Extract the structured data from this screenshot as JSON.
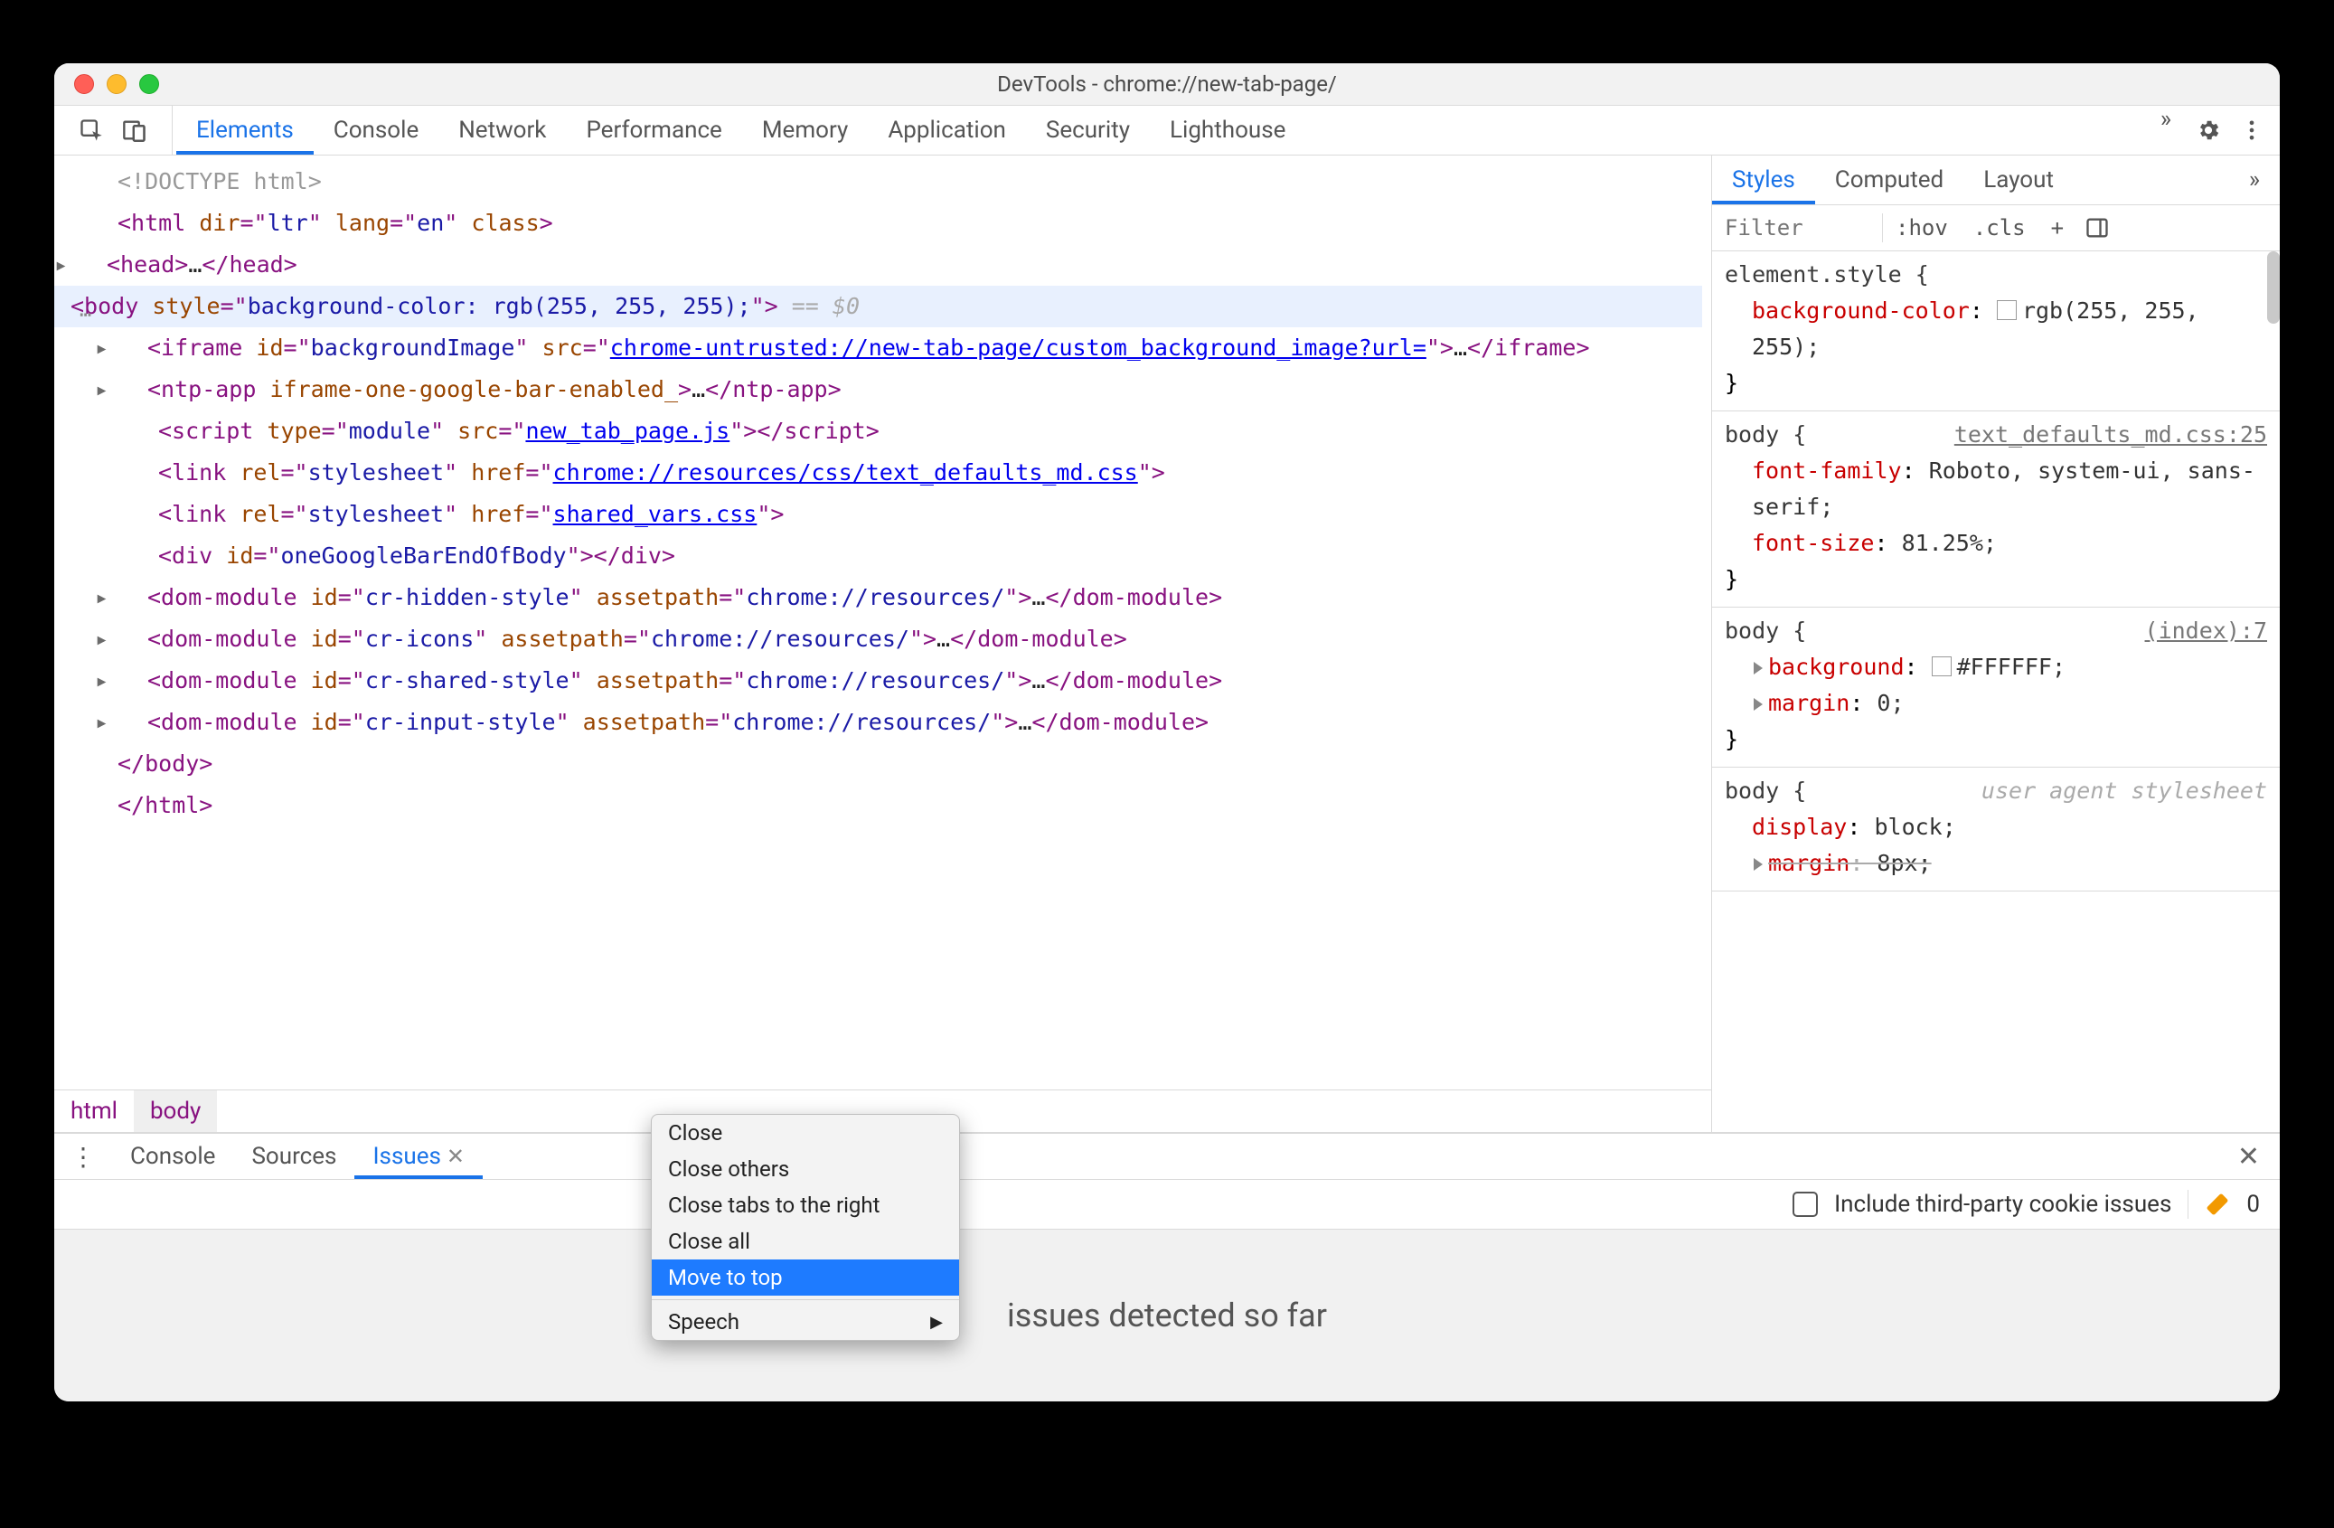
{
  "window": {
    "title": "DevTools - chrome://new-tab-page/"
  },
  "toolbar": {
    "tabs": [
      "Elements",
      "Console",
      "Network",
      "Performance",
      "Memory",
      "Application",
      "Security",
      "Lighthouse"
    ],
    "active": 0,
    "more_glyph": "»"
  },
  "dom": {
    "doctype": "<!DOCTYPE html>",
    "lines": [
      {
        "indent": 0,
        "raw": [
          {
            "t": "tg",
            "v": "<html "
          },
          {
            "t": "an",
            "v": "dir"
          },
          {
            "t": "tg",
            "v": "=\""
          },
          {
            "t": "av",
            "v": "ltr"
          },
          {
            "t": "tg",
            "v": "\" "
          },
          {
            "t": "an",
            "v": "lang"
          },
          {
            "t": "tg",
            "v": "=\""
          },
          {
            "t": "av",
            "v": "en"
          },
          {
            "t": "tg",
            "v": "\" "
          },
          {
            "t": "an",
            "v": "class"
          },
          {
            "t": "tg",
            "v": ">"
          }
        ]
      },
      {
        "indent": 1,
        "caret": "closed",
        "raw": [
          {
            "t": "tg",
            "v": "<head>"
          },
          {
            "t": "ell",
            "v": "…"
          },
          {
            "t": "tg",
            "v": "</head>"
          }
        ]
      },
      {
        "indent": 1,
        "caret": "open",
        "selected": true,
        "dots": true,
        "raw": [
          {
            "t": "tg",
            "v": "<body "
          },
          {
            "t": "an",
            "v": "style"
          },
          {
            "t": "tg",
            "v": "=\""
          },
          {
            "t": "av",
            "v": "background-color: rgb(255, 255, 255);"
          },
          {
            "t": "tg",
            "v": "\">"
          },
          {
            "t": "eqinfo",
            "v": " == $0"
          }
        ]
      },
      {
        "indent": 2,
        "caret": "closed",
        "raw": [
          {
            "t": "tg",
            "v": "<iframe "
          },
          {
            "t": "an",
            "v": "id"
          },
          {
            "t": "tg",
            "v": "=\""
          },
          {
            "t": "av",
            "v": "backgroundImage"
          },
          {
            "t": "tg",
            "v": "\" "
          },
          {
            "t": "an",
            "v": "src"
          },
          {
            "t": "tg",
            "v": "=\""
          },
          {
            "t": "link",
            "v": "chrome-untrusted://new-tab-page/custom_background_image?url="
          },
          {
            "t": "tg",
            "v": "\">"
          },
          {
            "t": "ell",
            "v": "…"
          },
          {
            "t": "tg",
            "v": "</iframe>"
          }
        ]
      },
      {
        "indent": 2,
        "caret": "closed",
        "raw": [
          {
            "t": "tg",
            "v": "<ntp-app "
          },
          {
            "t": "an",
            "v": "iframe-one-google-bar-enabled_"
          },
          {
            "t": "tg",
            "v": ">"
          },
          {
            "t": "ell",
            "v": "…"
          },
          {
            "t": "tg",
            "v": "</ntp-app>"
          }
        ]
      },
      {
        "indent": 2,
        "raw": [
          {
            "t": "tg",
            "v": "<script "
          },
          {
            "t": "an",
            "v": "type"
          },
          {
            "t": "tg",
            "v": "=\""
          },
          {
            "t": "av",
            "v": "module"
          },
          {
            "t": "tg",
            "v": "\" "
          },
          {
            "t": "an",
            "v": "src"
          },
          {
            "t": "tg",
            "v": "=\""
          },
          {
            "t": "link",
            "v": "new_tab_page.js"
          },
          {
            "t": "tg",
            "v": "\">"
          },
          {
            "t": "tg",
            "v": "</script>"
          }
        ]
      },
      {
        "indent": 2,
        "raw": [
          {
            "t": "tg",
            "v": "<link "
          },
          {
            "t": "an",
            "v": "rel"
          },
          {
            "t": "tg",
            "v": "=\""
          },
          {
            "t": "av",
            "v": "stylesheet"
          },
          {
            "t": "tg",
            "v": "\" "
          },
          {
            "t": "an",
            "v": "href"
          },
          {
            "t": "tg",
            "v": "=\""
          },
          {
            "t": "link",
            "v": "chrome://resources/css/text_defaults_md.css"
          },
          {
            "t": "tg",
            "v": "\">"
          }
        ]
      },
      {
        "indent": 2,
        "raw": [
          {
            "t": "tg",
            "v": "<link "
          },
          {
            "t": "an",
            "v": "rel"
          },
          {
            "t": "tg",
            "v": "=\""
          },
          {
            "t": "av",
            "v": "stylesheet"
          },
          {
            "t": "tg",
            "v": "\" "
          },
          {
            "t": "an",
            "v": "href"
          },
          {
            "t": "tg",
            "v": "=\""
          },
          {
            "t": "link",
            "v": "shared_vars.css"
          },
          {
            "t": "tg",
            "v": "\">"
          }
        ]
      },
      {
        "indent": 2,
        "raw": [
          {
            "t": "tg",
            "v": "<div "
          },
          {
            "t": "an",
            "v": "id"
          },
          {
            "t": "tg",
            "v": "=\""
          },
          {
            "t": "av",
            "v": "oneGoogleBarEndOfBody"
          },
          {
            "t": "tg",
            "v": "\">"
          },
          {
            "t": "tg",
            "v": "</div>"
          }
        ]
      },
      {
        "indent": 2,
        "caret": "closed",
        "raw": [
          {
            "t": "tg",
            "v": "<dom-module "
          },
          {
            "t": "an",
            "v": "id"
          },
          {
            "t": "tg",
            "v": "=\""
          },
          {
            "t": "av",
            "v": "cr-hidden-style"
          },
          {
            "t": "tg",
            "v": "\" "
          },
          {
            "t": "an",
            "v": "assetpath"
          },
          {
            "t": "tg",
            "v": "=\""
          },
          {
            "t": "av",
            "v": "chrome://resources/"
          },
          {
            "t": "tg",
            "v": "\">"
          },
          {
            "t": "ell",
            "v": "…"
          },
          {
            "t": "tg",
            "v": "</dom-module>"
          }
        ]
      },
      {
        "indent": 2,
        "caret": "closed",
        "raw": [
          {
            "t": "tg",
            "v": "<dom-module "
          },
          {
            "t": "an",
            "v": "id"
          },
          {
            "t": "tg",
            "v": "=\""
          },
          {
            "t": "av",
            "v": "cr-icons"
          },
          {
            "t": "tg",
            "v": "\" "
          },
          {
            "t": "an",
            "v": "assetpath"
          },
          {
            "t": "tg",
            "v": "=\""
          },
          {
            "t": "av",
            "v": "chrome://resources/"
          },
          {
            "t": "tg",
            "v": "\">"
          },
          {
            "t": "ell",
            "v": "…"
          },
          {
            "t": "tg",
            "v": "</dom-module>"
          }
        ]
      },
      {
        "indent": 2,
        "caret": "closed",
        "raw": [
          {
            "t": "tg",
            "v": "<dom-module "
          },
          {
            "t": "an",
            "v": "id"
          },
          {
            "t": "tg",
            "v": "=\""
          },
          {
            "t": "av",
            "v": "cr-shared-style"
          },
          {
            "t": "tg",
            "v": "\" "
          },
          {
            "t": "an",
            "v": "assetpath"
          },
          {
            "t": "tg",
            "v": "=\""
          },
          {
            "t": "av",
            "v": "chrome://resources/"
          },
          {
            "t": "tg",
            "v": "\">"
          },
          {
            "t": "ell",
            "v": "…"
          },
          {
            "t": "tg",
            "v": "</dom-module>"
          }
        ]
      },
      {
        "indent": 2,
        "caret": "closed",
        "raw": [
          {
            "t": "tg",
            "v": "<dom-module "
          },
          {
            "t": "an",
            "v": "id"
          },
          {
            "t": "tg",
            "v": "=\""
          },
          {
            "t": "av",
            "v": "cr-input-style"
          },
          {
            "t": "tg",
            "v": "\" "
          },
          {
            "t": "an",
            "v": "assetpath"
          },
          {
            "t": "tg",
            "v": "=\""
          },
          {
            "t": "av",
            "v": "chrome://resources/"
          },
          {
            "t": "tg",
            "v": "\">"
          },
          {
            "t": "ell",
            "v": "…"
          },
          {
            "t": "tg",
            "v": "</dom-module>"
          }
        ]
      },
      {
        "indent": 1,
        "raw": [
          {
            "t": "tg",
            "v": "</body>"
          }
        ]
      },
      {
        "indent": 0,
        "raw": [
          {
            "t": "tg",
            "v": "</html>"
          }
        ]
      }
    ]
  },
  "crumbs": [
    "html",
    "body"
  ],
  "styles": {
    "tabs": [
      "Styles",
      "Computed",
      "Layout"
    ],
    "active": 0,
    "filter_placeholder": "Filter",
    "hov": ":hov",
    "cls": ".cls",
    "rules": [
      {
        "selector": "element.style {",
        "source": "",
        "decls": [
          {
            "prop": "background-color",
            "val": "rgb(255, 255, 255)",
            "swatch": "#ffffff"
          }
        ],
        "close": "}"
      },
      {
        "selector": "body {",
        "source": "text_defaults_md.css:25",
        "decls": [
          {
            "prop": "font-family",
            "val": "Roboto, system-ui, sans-serif"
          },
          {
            "prop": "font-size",
            "val": "81.25%"
          }
        ],
        "close": "}"
      },
      {
        "selector": "body {",
        "source": "(index):7",
        "decls": [
          {
            "prop": "background",
            "val": "#FFFFFF",
            "tri": true,
            "swatch": "#ffffff"
          },
          {
            "prop": "margin",
            "val": "0",
            "tri": true
          }
        ],
        "close": "}"
      },
      {
        "selector": "body {",
        "source": "user agent stylesheet",
        "ua": true,
        "decls": [
          {
            "prop": "display",
            "val": "block"
          },
          {
            "prop": "margin",
            "val": "8px",
            "tri": true,
            "strike": true
          }
        ],
        "close": ""
      }
    ]
  },
  "drawer": {
    "tabs": [
      "Console",
      "Sources",
      "Issues"
    ],
    "active": 2,
    "include_label": "Include third-party cookie issues",
    "issue_count": "0",
    "empty": "issues detected so far"
  },
  "context_menu": {
    "items": [
      {
        "label": "Close"
      },
      {
        "label": "Close others"
      },
      {
        "label": "Close tabs to the right"
      },
      {
        "label": "Close all"
      },
      {
        "label": "Move to top",
        "highlight": true
      },
      {
        "sep": true
      },
      {
        "label": "Speech",
        "submenu": true
      }
    ]
  }
}
